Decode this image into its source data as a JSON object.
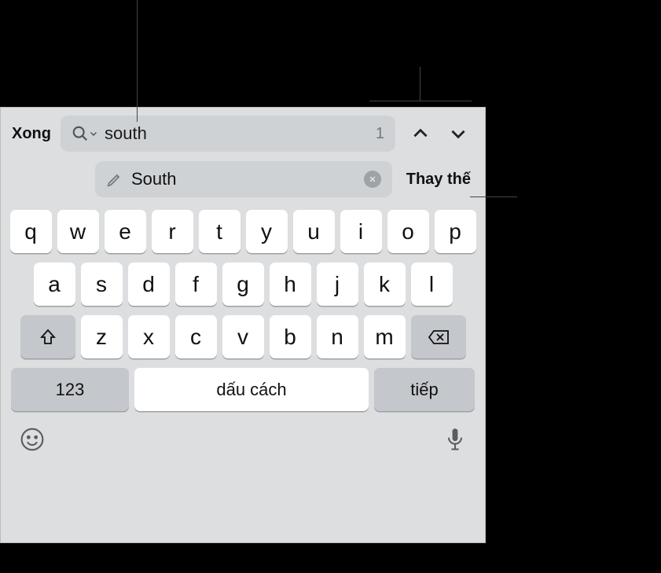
{
  "topbar": {
    "done_label": "Xong",
    "search_value": "south",
    "result_count": "1"
  },
  "replace": {
    "value": "South",
    "action_label": "Thay thế"
  },
  "keyboard": {
    "row1": [
      "q",
      "w",
      "e",
      "r",
      "t",
      "y",
      "u",
      "i",
      "o",
      "p"
    ],
    "row2": [
      "a",
      "s",
      "d",
      "f",
      "g",
      "h",
      "j",
      "k",
      "l"
    ],
    "row3": [
      "z",
      "x",
      "c",
      "v",
      "b",
      "n",
      "m"
    ],
    "numbers_label": "123",
    "space_label": "dấu cách",
    "next_label": "tiếp"
  }
}
